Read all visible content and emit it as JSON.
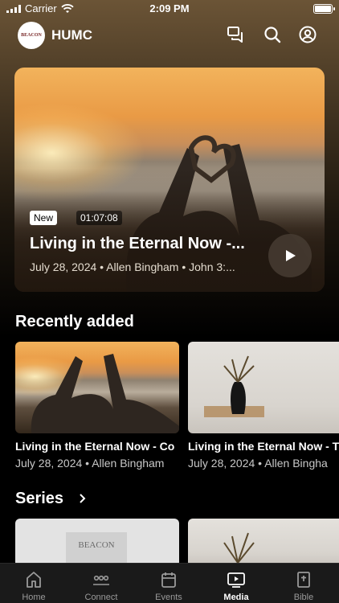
{
  "status_bar": {
    "carrier": "Carrier",
    "time": "2:09 PM"
  },
  "header": {
    "logo_text": "BEACON",
    "title": "HUMC",
    "icons": [
      "chat-icon",
      "search-icon",
      "account-icon"
    ]
  },
  "featured": {
    "badge": "New",
    "duration": "01:07:08",
    "title": "Living in the Eternal Now -...",
    "meta": "July 28, 2024 • Allen Bingham • John 3:..."
  },
  "recently_added": {
    "heading": "Recently added",
    "items": [
      {
        "title": "Living in the Eternal Now - Co",
        "meta": "July 28, 2024 • Allen Bingham"
      },
      {
        "title": "Living in the Eternal Now - T",
        "meta": "July 28, 2024 • Allen Bingha"
      }
    ]
  },
  "series": {
    "heading": "Series",
    "logo_text": "BEACON"
  },
  "tabbar": {
    "tabs": [
      {
        "label": "Home",
        "icon": "home-icon"
      },
      {
        "label": "Connect",
        "icon": "people-icon"
      },
      {
        "label": "Events",
        "icon": "calendar-icon"
      },
      {
        "label": "Media",
        "icon": "play-media-icon",
        "active": true
      },
      {
        "label": "Bible",
        "icon": "bible-icon"
      }
    ]
  }
}
